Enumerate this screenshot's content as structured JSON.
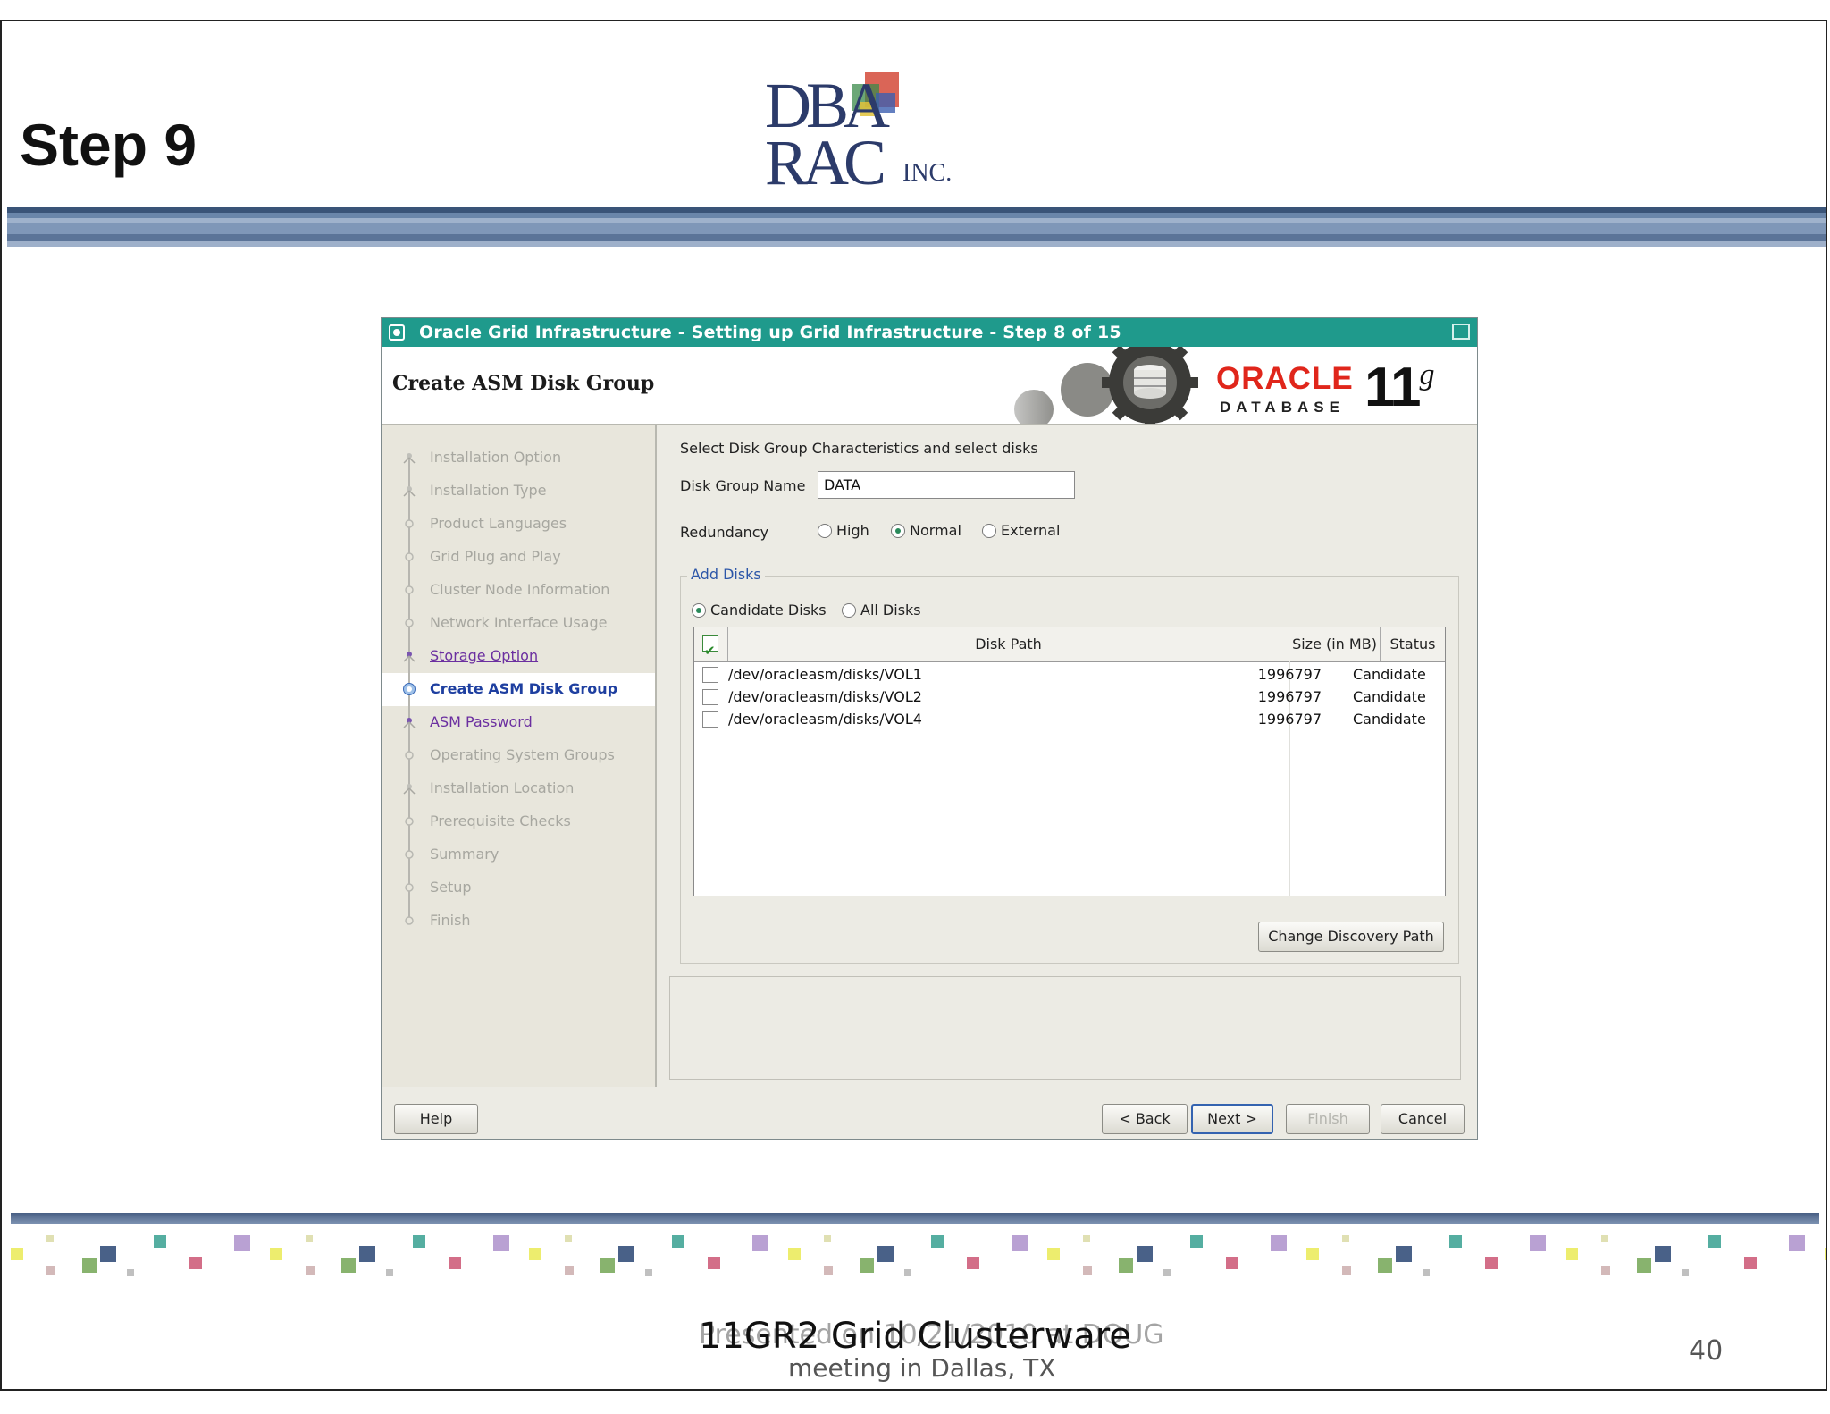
{
  "slide": {
    "title": "Step 9",
    "logo_text": "DBA RAC INC.",
    "footer_title": "11GR2 Grid Clusterware",
    "footer_overlap": "Presented on 10/21/2010 at DOUG",
    "footer_sub": "meeting in Dallas, TX",
    "page_number": "40"
  },
  "dialog": {
    "window_title": "Oracle Grid Infrastructure - Setting up Grid Infrastructure - Step 8 of 15",
    "heading": "Create ASM Disk Group",
    "brand": {
      "oracle": "ORACLE",
      "database": "DATABASE",
      "version": "11",
      "version_sup": "g",
      "oracle_color": "#e0261b"
    },
    "steps": [
      {
        "label": "Installation Option",
        "state": "done"
      },
      {
        "label": "Installation Type",
        "state": "done"
      },
      {
        "label": "Product Languages",
        "state": "pending"
      },
      {
        "label": "Grid Plug and Play",
        "state": "pending"
      },
      {
        "label": "Cluster Node Information",
        "state": "pending"
      },
      {
        "label": "Network Interface Usage",
        "state": "pending"
      },
      {
        "label": "Storage Option",
        "state": "visited"
      },
      {
        "label": "Create ASM Disk Group",
        "state": "current"
      },
      {
        "label": "ASM Password",
        "state": "visited"
      },
      {
        "label": "Operating System Groups",
        "state": "pending"
      },
      {
        "label": "Installation Location",
        "state": "done"
      },
      {
        "label": "Prerequisite Checks",
        "state": "pending"
      },
      {
        "label": "Summary",
        "state": "pending"
      },
      {
        "label": "Setup",
        "state": "pending"
      },
      {
        "label": "Finish",
        "state": "pending"
      }
    ],
    "instructions": "Select Disk Group Characteristics and select disks",
    "disk_group_name_label": "Disk Group Name",
    "disk_group_name_value": "DATA",
    "redundancy_label": "Redundancy",
    "redundancy_options": [
      {
        "label": "High",
        "selected": false
      },
      {
        "label": "Normal",
        "selected": true
      },
      {
        "label": "External",
        "selected": false
      }
    ],
    "add_disks_legend": "Add Disks",
    "disk_filter_options": [
      {
        "label": "Candidate Disks",
        "selected": true
      },
      {
        "label": "All Disks",
        "selected": false
      }
    ],
    "table": {
      "columns": [
        "Disk Path",
        "Size (in MB)",
        "Status"
      ],
      "select_all_checked": true,
      "rows": [
        {
          "path": "/dev/oracleasm/disks/VOL1",
          "size": "1996797",
          "status": "Candidate",
          "checked": false
        },
        {
          "path": "/dev/oracleasm/disks/VOL2",
          "size": "1996797",
          "status": "Candidate",
          "checked": false
        },
        {
          "path": "/dev/oracleasm/disks/VOL4",
          "size": "1996797",
          "status": "Candidate",
          "checked": false
        }
      ]
    },
    "change_discovery_path": "Change Discovery Path",
    "buttons": {
      "help": "Help",
      "back": "< Back",
      "next": "Next >",
      "finish": "Finish",
      "cancel": "Cancel"
    }
  }
}
